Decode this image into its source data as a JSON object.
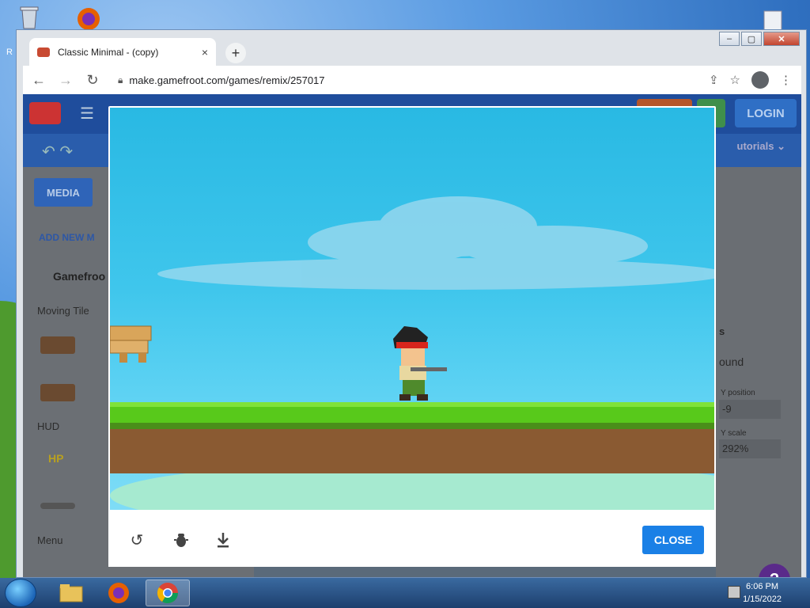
{
  "desktop": {
    "label_recycle": "R"
  },
  "browser": {
    "tab_title": "Classic Minimal - (copy)",
    "tab_close": "×",
    "new_tab": "+",
    "url": "make.gamefroot.com/games/remix/257017",
    "window_min": "‒",
    "window_max": "▢",
    "window_close": "✕"
  },
  "app": {
    "login_label": "LOGIN",
    "tutorials_label": "utorials ⌄",
    "media_label": "MEDIA",
    "add_new_label": "ADD NEW M",
    "folder_label": "Gamefroo",
    "section_moving_tile": "Moving Tile",
    "section_hud": "HUD",
    "section_menu": "Menu",
    "hud_hp": "HP",
    "rp_dropdown_value": "ound",
    "rp_y_position_label": "Y position",
    "rp_y_position_value": "-9",
    "rp_y_scale_label": "Y scale",
    "rp_y_scale_value": "292%",
    "rp_section_letter": "s",
    "help_label": "?"
  },
  "modal": {
    "close_label": "CLOSE"
  },
  "taskbar": {
    "time": "6:06 PM",
    "date": "1/15/2022"
  },
  "colors": {
    "accent_blue": "#1a80e6",
    "app_header": "#1f4d9c",
    "sky": "#3fc6ec",
    "grass": "#58c91b",
    "dirt": "#8a5a32"
  }
}
